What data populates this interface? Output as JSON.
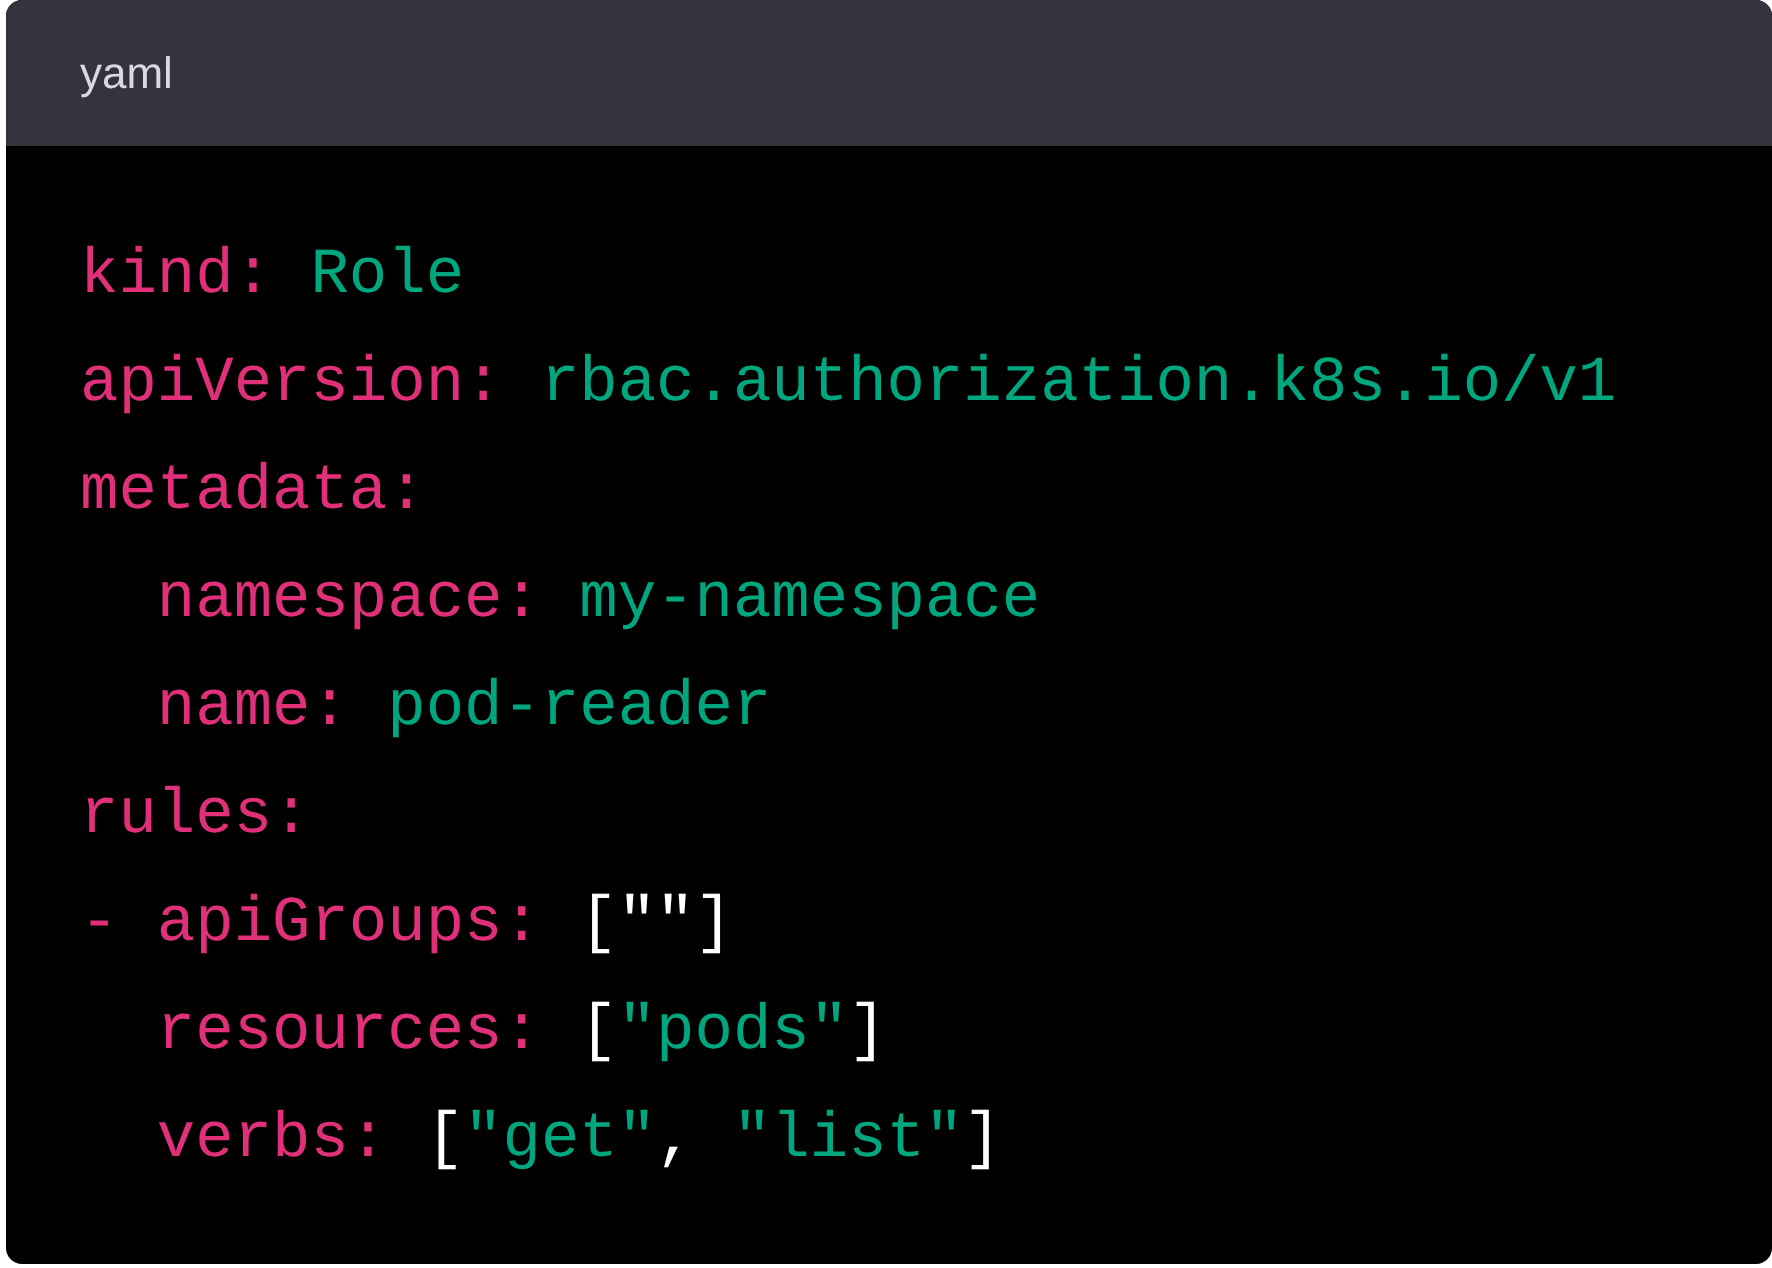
{
  "code_block": {
    "language": "yaml",
    "lines": [
      [
        {
          "text": "kind:",
          "kind": "key"
        },
        {
          "text": " Role",
          "kind": "string"
        }
      ],
      [
        {
          "text": "apiVersion:",
          "kind": "key"
        },
        {
          "text": " rbac.authorization.k8s.io/v1",
          "kind": "string"
        }
      ],
      [
        {
          "text": "metadata:",
          "kind": "key"
        }
      ],
      [
        {
          "text": "  namespace:",
          "kind": "key"
        },
        {
          "text": " my-namespace",
          "kind": "string"
        }
      ],
      [
        {
          "text": "  name:",
          "kind": "key"
        },
        {
          "text": " pod-reader",
          "kind": "string"
        }
      ],
      [
        {
          "text": "rules:",
          "kind": "key"
        }
      ],
      [
        {
          "text": "- apiGroups:",
          "kind": "key"
        },
        {
          "text": " [\"\"]",
          "kind": "punct"
        }
      ],
      [
        {
          "text": "  resources:",
          "kind": "key"
        },
        {
          "text": " [",
          "kind": "punct"
        },
        {
          "text": "\"pods\"",
          "kind": "string"
        },
        {
          "text": "]",
          "kind": "punct"
        }
      ],
      [
        {
          "text": "  verbs:",
          "kind": "key"
        },
        {
          "text": " [",
          "kind": "punct"
        },
        {
          "text": "\"get\"",
          "kind": "string"
        },
        {
          "text": ", ",
          "kind": "punct"
        },
        {
          "text": "\"list\"",
          "kind": "string"
        },
        {
          "text": "]",
          "kind": "punct"
        }
      ]
    ]
  }
}
